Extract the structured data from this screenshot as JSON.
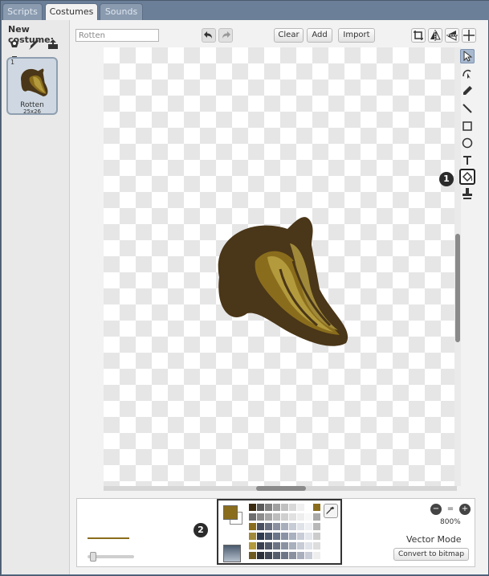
{
  "tabs": [
    {
      "label": "Scripts",
      "active": false
    },
    {
      "label": "Costumes",
      "active": true
    },
    {
      "label": "Sounds",
      "active": false
    }
  ],
  "left_panel": {
    "new_costume_label": "New costume:",
    "new_costume_icons": [
      "paint-from-library-icon",
      "paint-brush-icon",
      "upload-icon",
      "camera-icon"
    ],
    "costumes": [
      {
        "number": "1",
        "name": "Rotten",
        "size": "25x26"
      }
    ]
  },
  "toolbar": {
    "costume_name_value": "Rotten",
    "undo_icon": "undo-icon",
    "redo_icon": "redo-icon",
    "clear_label": "Clear",
    "add_label": "Add",
    "import_label": "Import",
    "right_icons": [
      "crop-icon",
      "flip-horizontal-icon",
      "flip-vertical-icon",
      "set-center-icon"
    ]
  },
  "tools": [
    "select-arrow-icon",
    "reshape-icon",
    "pencil-icon",
    "line-icon",
    "rectangle-icon",
    "ellipse-icon",
    "text-icon",
    "fill-bucket-icon",
    "stamp-icon"
  ],
  "selected_tool": "select-arrow-icon",
  "markers": {
    "tool_marker": "1",
    "palette_marker": "2"
  },
  "bottom": {
    "zoom_level": "800%",
    "mode_label": "Vector Mode",
    "convert_label": "Convert to bitmap",
    "primary_color": "#8a6d1c",
    "secondary_color": "#ffffff",
    "line_width_fraction": 0.05
  },
  "colors": {
    "banana_dark": "#4a3618",
    "banana_mid": "#8a6d1c",
    "banana_light": "#b39a3c",
    "accent": "#a7b8cf"
  },
  "palette": [
    [
      "#3a2a10",
      "#5a5a5a",
      "#808080",
      "#a0a0a0",
      "#c0c0c0",
      "#d8d8d8",
      "#f0f0f0",
      "#ffffff",
      "#8a6d1c"
    ],
    [
      "#6e6e6e",
      "#8c8c8c",
      "#a6a6a6",
      "#bdbdbd",
      "#cfcfcf",
      "#e0e0e0",
      "#eeeeee",
      "#f8f8f8",
      "#aaaaaa"
    ],
    [
      "#8a6d1c",
      "#4a4f60",
      "#6a6f80",
      "#8a90a0",
      "#a8aebc",
      "#c6cbd5",
      "#dfe2e8",
      "#eef0f3",
      "#b8b8b8"
    ],
    [
      "#a08a3a",
      "#2e3a4e",
      "#4a566a",
      "#6a7588",
      "#8993a5",
      "#a9b1c0",
      "#c8cdd7",
      "#e3e6ec",
      "#cccccc"
    ],
    [
      "#b39a3c",
      "#3a4050",
      "#505868",
      "#6c7484",
      "#8a92a2",
      "#a8afbd",
      "#c6cbd5",
      "#e0e3e9",
      "#dddddd"
    ],
    [
      "#6e5a20",
      "#2a2f3a",
      "#3f4553",
      "#555c6c",
      "#6e7586",
      "#8a90a0",
      "#a8aebc",
      "#c8ccd6",
      "#eeeeee"
    ]
  ]
}
